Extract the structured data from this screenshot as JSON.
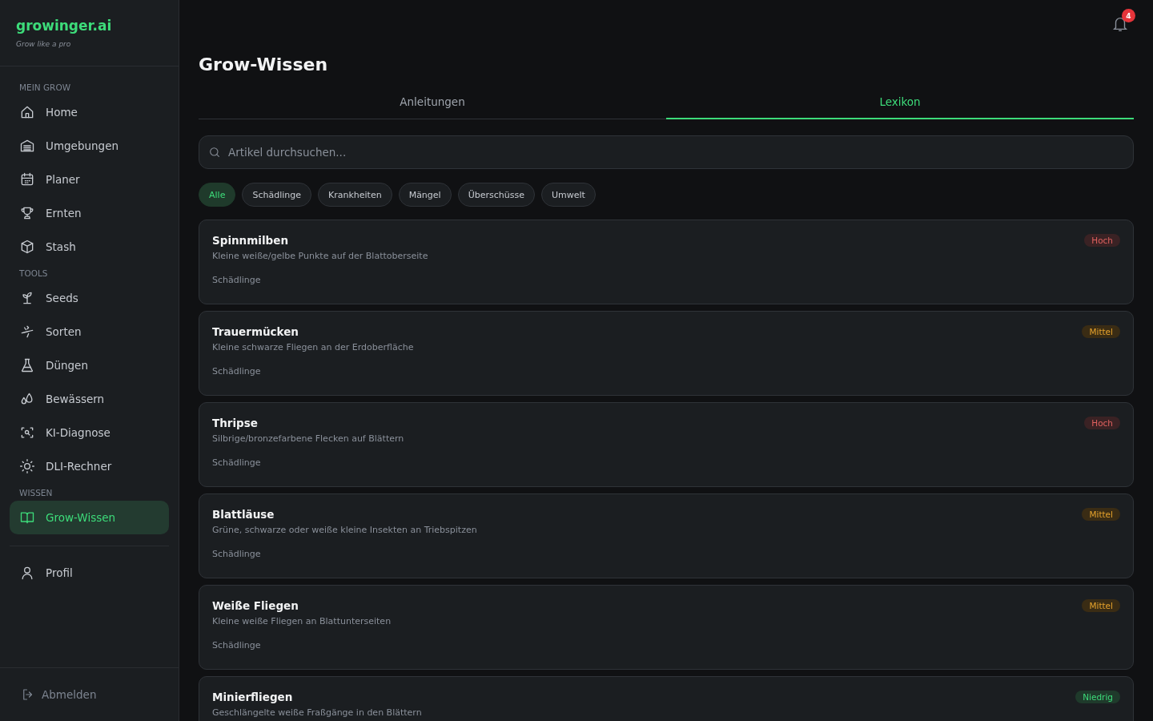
{
  "brand": {
    "name": "growinger.ai",
    "tagline": "Grow like a pro"
  },
  "sidebar": {
    "sections": [
      {
        "title": "MEIN GROW",
        "items": [
          {
            "label": "Home",
            "selected": false
          },
          {
            "label": "Umgebungen",
            "selected": false
          },
          {
            "label": "Planer",
            "selected": false
          },
          {
            "label": "Ernten",
            "selected": false
          },
          {
            "label": "Stash",
            "selected": false
          }
        ]
      },
      {
        "title": "TOOLS",
        "items": [
          {
            "label": "Seeds",
            "selected": false
          },
          {
            "label": "Sorten",
            "selected": false
          },
          {
            "label": "Düngen",
            "selected": false
          },
          {
            "label": "Bewässern",
            "selected": false
          },
          {
            "label": "KI-Diagnose",
            "selected": false
          },
          {
            "label": "DLI-Rechner",
            "selected": false
          }
        ]
      },
      {
        "title": "WISSEN",
        "items": [
          {
            "label": "Grow-Wissen",
            "selected": true
          }
        ]
      }
    ],
    "bottom_items": [
      {
        "label": "Profil",
        "selected": false
      }
    ],
    "logout": "Abmelden"
  },
  "notifications": {
    "count": "4"
  },
  "page_title": "Grow-Wissen",
  "tabs": [
    {
      "label": "Anleitungen",
      "selected": false
    },
    {
      "label": "Lexikon",
      "selected": true
    }
  ],
  "search": {
    "placeholder": "Artikel durchsuchen..."
  },
  "filters": [
    {
      "label": "Alle",
      "selected": true
    },
    {
      "label": "Schädlinge",
      "selected": false
    },
    {
      "label": "Krankheiten",
      "selected": false
    },
    {
      "label": "Mängel",
      "selected": false
    },
    {
      "label": "Überschüsse",
      "selected": false
    },
    {
      "label": "Umwelt",
      "selected": false
    }
  ],
  "articles": [
    {
      "title": "Spinnmilben",
      "description": "Kleine weiße/gelbe Punkte auf der Blattoberseite",
      "category": "Schädlinge",
      "severity": "Hoch",
      "kind": "high"
    },
    {
      "title": "Trauermücken",
      "description": "Kleine schwarze Fliegen an der Erdoberfläche",
      "category": "Schädlinge",
      "severity": "Mittel",
      "kind": "medium"
    },
    {
      "title": "Thripse",
      "description": "Silbrige/bronzefarbene Flecken auf Blättern",
      "category": "Schädlinge",
      "severity": "Hoch",
      "kind": "high"
    },
    {
      "title": "Blattläuse",
      "description": "Grüne, schwarze oder weiße kleine Insekten an Triebspitzen",
      "category": "Schädlinge",
      "severity": "Mittel",
      "kind": "medium"
    },
    {
      "title": "Weiße Fliegen",
      "description": "Kleine weiße Fliegen an Blattunterseiten",
      "category": "Schädlinge",
      "severity": "Mittel",
      "kind": "medium"
    },
    {
      "title": "Minierfliegen",
      "description": "Geschlängelte weiße Fraßgänge in den Blättern",
      "severity": "Niedrig",
      "kind": "low"
    }
  ]
}
